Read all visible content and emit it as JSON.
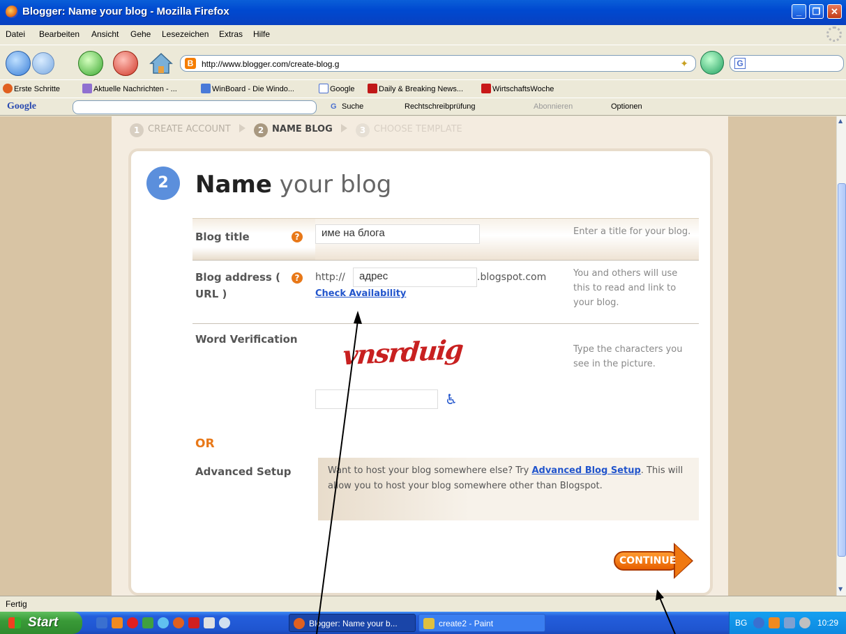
{
  "window": {
    "title": "Blogger: Name your blog - Mozilla Firefox"
  },
  "menu": [
    "Datei",
    "Bearbeiten",
    "Ansicht",
    "Gehe",
    "Lesezeichen",
    "Extras",
    "Hilfe"
  ],
  "navigation": {
    "url": "http://www.blogger.com/create-blog.g"
  },
  "bookmarks": [
    "Erste Schritte",
    "Aktuelle Nachrichten - ...",
    "WinBoard - Die Windo...",
    "Google",
    "Daily & Breaking News...",
    "WirtschaftsWoche"
  ],
  "google_toolbar": {
    "logo": "Google",
    "search": "Suche",
    "spellcheck": "Rechtschreibprüfung",
    "subscribe": "Abonnieren",
    "options": "Optionen"
  },
  "steps": [
    {
      "num": "1",
      "label": "CREATE ACCOUNT",
      "state": "done"
    },
    {
      "num": "2",
      "label": "NAME BLOG",
      "state": "current"
    },
    {
      "num": "3",
      "label": "CHOOSE TEMPLATE",
      "state": "upcoming"
    }
  ],
  "form": {
    "step_number": "2",
    "heading_bold": "Name",
    "heading_rest": "your blog",
    "blog_title": {
      "label": "Blog title",
      "value": "име на блога",
      "hint": "Enter a title for your blog."
    },
    "blog_address": {
      "label": "Blog address ( URL )",
      "prefix": "http://",
      "value": "адрес",
      "suffix": ".blogspot.com",
      "check_link": "Check Availability",
      "hint": "You and others will use this to read and link to your blog."
    },
    "word_verification": {
      "label": "Word Verification",
      "captcha": "vnsrduig",
      "hint": "Type the characters you see in the picture.",
      "input_value": ""
    },
    "or_label": "OR",
    "advanced": {
      "label": "Advanced Setup",
      "text_before": "Want to host your blog somewhere else? Try ",
      "link": "Advanced Blog Setup",
      "text_after": ". This will allow you to host your blog somewhere other than Blogspot."
    },
    "continue_label": "CONTINUE"
  },
  "status": {
    "text": "Fertig"
  },
  "taskbar": {
    "start": "Start",
    "tasks": [
      "Blogger: Name your b...",
      "create2 - Paint"
    ],
    "language": "BG",
    "clock": "10:29"
  },
  "colors": {
    "accent_orange": "#e87818",
    "link_blue": "#2255cc",
    "step_blue": "#5b8fdc",
    "page_bg": "#d8c4a4"
  }
}
